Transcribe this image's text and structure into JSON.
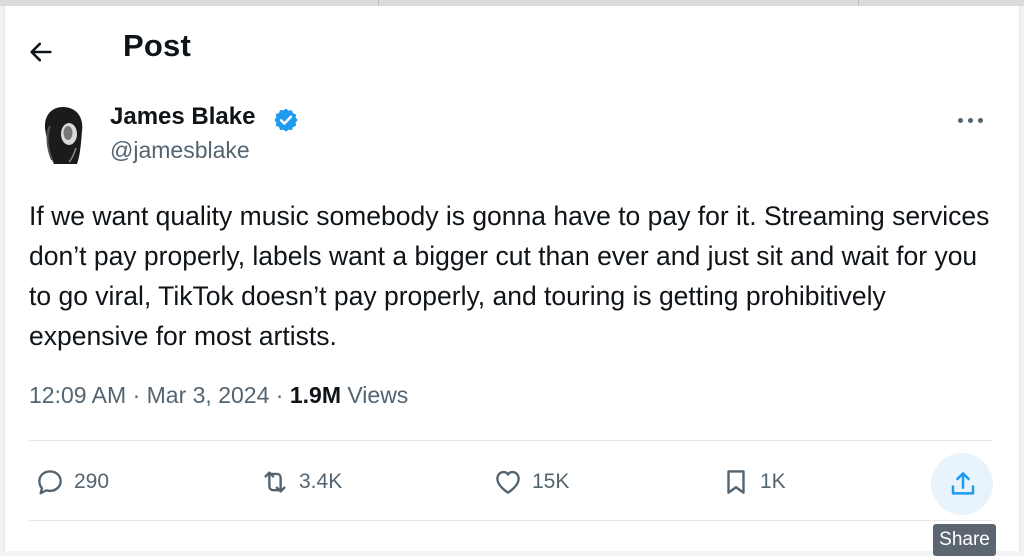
{
  "header": {
    "title": "Post"
  },
  "author": {
    "name": "James Blake",
    "handle": "@jamesblake"
  },
  "tweet": {
    "text": "If we want quality music somebody is gonna have to pay for it. Streaming services don’t pay properly, labels want a bigger cut than ever and just sit and wait for you to go viral, TikTok doesn’t pay properly, and touring is getting prohibitively expensive for most artists."
  },
  "meta": {
    "time": "12:09 AM",
    "separator": "·",
    "date": "Mar 3, 2024",
    "views_count": "1.9M",
    "views_label": "Views"
  },
  "actions": {
    "replies": "290",
    "reposts": "3.4K",
    "likes": "15K",
    "bookmarks": "1K"
  },
  "tooltip": {
    "share": "Share"
  },
  "icons": [
    "back-arrow-icon",
    "verified-badge-icon",
    "more-icon",
    "reply-icon",
    "repost-icon",
    "like-icon",
    "bookmark-icon",
    "share-icon"
  ],
  "colors": {
    "verified": "#1d9bf0",
    "muted": "#536471",
    "text": "#0f1419",
    "share_bg": "#e8f3fb",
    "share_icon": "#1d9bf0"
  }
}
